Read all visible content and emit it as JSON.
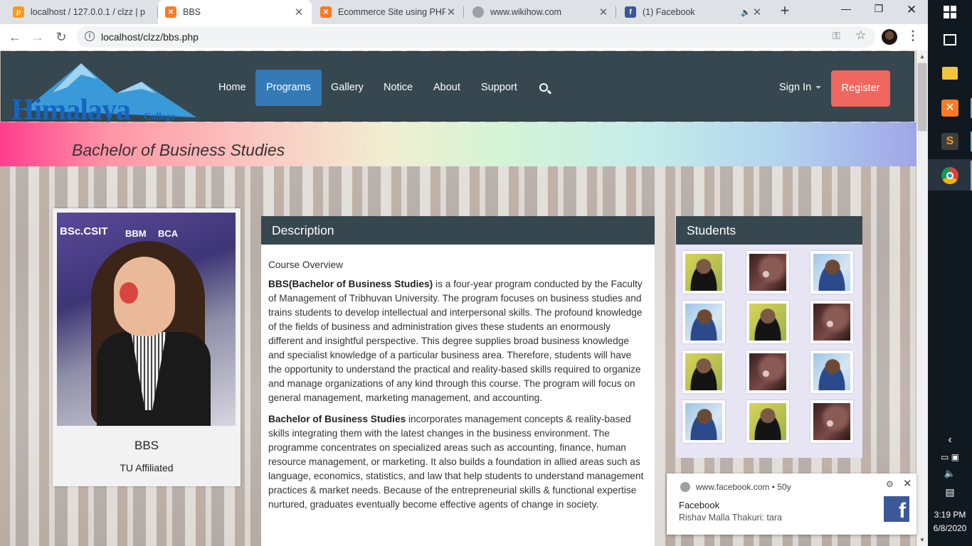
{
  "browser": {
    "tabs": [
      {
        "title": "localhost / 127.0.0.1 / clzz | p",
        "favicon": "phpmyadmin-icon",
        "color": "#f89c1c"
      },
      {
        "title": "BBS",
        "favicon": "xampp-icon",
        "color": "#fb7a24"
      },
      {
        "title": "Ecommerce Site using PHP",
        "favicon": "xampp-icon",
        "color": "#fb7a24"
      },
      {
        "title": "www.wikihow.com",
        "favicon": "globe-icon",
        "color": "#9aa0a6"
      },
      {
        "title": "(1) Facebook",
        "favicon": "facebook-icon",
        "color": "#3b5998"
      }
    ],
    "url": "localhost/clzz/bbs.php"
  },
  "site": {
    "logo_word": "Himalaya",
    "logo_sub": "College",
    "nav": [
      "Home",
      "Programs",
      "Gallery",
      "Notice",
      "About",
      "Support"
    ],
    "active_nav": "Programs",
    "sign_in": "Sign In",
    "register": "Register",
    "accent_color": "#f0675f",
    "nav_bg": "#37474f"
  },
  "banner": {
    "title": "Bachelor of Business Studies"
  },
  "profile_card": {
    "title": "BBS",
    "subtitle": "TU Affiliated",
    "signage": [
      "BSc.CSIT",
      "BBM",
      "BCA"
    ]
  },
  "description": {
    "heading": "Description",
    "overview_label": "Course Overview",
    "p1_bold": "BBS(Bachelor of Business Studies)",
    "p1_text": " is a four-year program conducted by the Faculty of Management of Tribhuvan University. The program focuses on business studies and trains students to develop intellectual and interpersonal skills. The profound knowledge of the fields of business and administration gives these students an enormously different and insightful perspective. This degree supplies broad business knowledge and specialist knowledge of a particular business area. Therefore, students will have the opportunity to understand the practical and reality-based skills required to organize and manage organizations of any kind through this course. The program will focus on general management, marketing management, and accounting.",
    "p2_bold": "Bachelor of Business Studies",
    "p2_text": " incorporates management concepts & reality-based skills integrating them with the latest changes in the business environment. The programme concentrates on specialized areas such as accounting, finance, human resource management, or marketing. It also builds a foundation in allied areas such as language, economics, statistics, and law that help students to understand management practices & market needs. Because of the entrepreneurial skills & functional expertise nurtured, graduates eventually become effective agents of change in society."
  },
  "students": {
    "heading": "Students",
    "thumbnails": [
      "a",
      "b",
      "c",
      "c",
      "a",
      "b",
      "a",
      "b",
      "c",
      "c",
      "a",
      "b"
    ]
  },
  "notification": {
    "site": "www.facebook.com",
    "age": "50y",
    "title": "Facebook",
    "message": "Rishav Malla Thakuri: tara"
  },
  "taskbar": {
    "time": "3:19 PM",
    "date": "6/8/2020"
  }
}
